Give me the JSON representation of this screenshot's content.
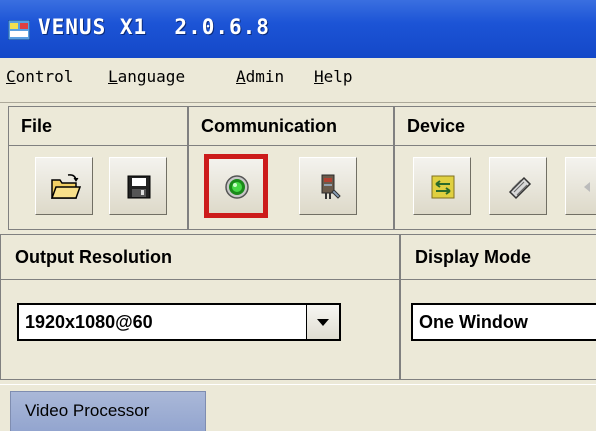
{
  "window": {
    "title": "VENUS X1  2.0.6.8",
    "icon": "app-icon"
  },
  "menu": {
    "items": [
      {
        "label": "Control",
        "accelerator": "C"
      },
      {
        "label": "Language",
        "accelerator": "L"
      },
      {
        "label": "Admin",
        "accelerator": "A"
      },
      {
        "label": "Help",
        "accelerator": "H"
      }
    ]
  },
  "toolbar": {
    "groups": [
      {
        "title": "File",
        "buttons": [
          {
            "icon": "open-folder-icon"
          },
          {
            "icon": "save-disk-icon"
          }
        ]
      },
      {
        "title": "Communication",
        "buttons": [
          {
            "icon": "connect-green-light-icon",
            "highlighted": true
          },
          {
            "icon": "disconnect-icon"
          }
        ]
      },
      {
        "title": "Device",
        "buttons": [
          {
            "icon": "swap-arrows-icon"
          },
          {
            "icon": "diamond-tool-icon"
          },
          {
            "icon": "more-icon"
          }
        ]
      }
    ]
  },
  "panels": {
    "output_resolution": {
      "title": "Output Resolution",
      "value": "1920x1080@60"
    },
    "display_mode": {
      "title": "Display Mode",
      "value": "One Window"
    }
  },
  "tabs": [
    {
      "label": "Video Processor",
      "active": true
    }
  ],
  "colors": {
    "titlebar": "#1c54d6",
    "highlight": "#cc1b1b",
    "face": "#ece9d8"
  }
}
